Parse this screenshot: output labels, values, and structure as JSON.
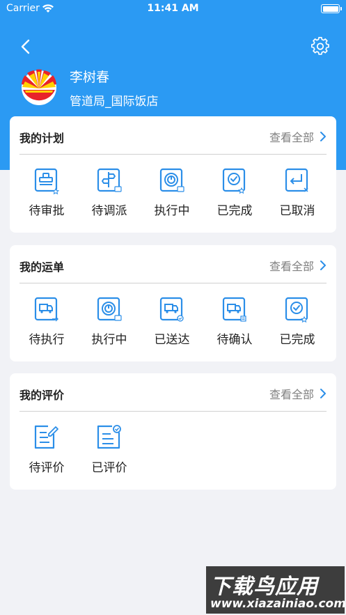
{
  "status_bar": {
    "carrier": "Carrier",
    "time": "11:41 AM"
  },
  "header": {
    "back_icon": "chevron-left-icon",
    "settings_icon": "gear-icon",
    "user_name": "李树春",
    "user_org": "管道局_国际饭店",
    "colors": {
      "primary": "#2b9af3",
      "icon_blue": "#2b8ee8"
    }
  },
  "plans": {
    "title": "我的计划",
    "more": "查看全部",
    "items": [
      {
        "label": "待审批",
        "icon": "pending-approval-icon"
      },
      {
        "label": "待调派",
        "icon": "pending-dispatch-icon"
      },
      {
        "label": "执行中",
        "icon": "in-progress-icon"
      },
      {
        "label": "已完成",
        "icon": "completed-icon"
      },
      {
        "label": "已取消",
        "icon": "cancelled-icon"
      }
    ]
  },
  "waybills": {
    "title": "我的运单",
    "more": "查看全部",
    "items": [
      {
        "label": "待执行",
        "icon": "truck-pending-icon"
      },
      {
        "label": "执行中",
        "icon": "in-progress-icon"
      },
      {
        "label": "已送达",
        "icon": "truck-delivered-icon"
      },
      {
        "label": "待确认",
        "icon": "truck-confirm-icon"
      },
      {
        "label": "已完成",
        "icon": "completed-icon"
      }
    ]
  },
  "reviews": {
    "title": "我的评价",
    "more": "查看全部",
    "items": [
      {
        "label": "待评价",
        "icon": "pending-review-icon"
      },
      {
        "label": "已评价",
        "icon": "reviewed-icon"
      }
    ]
  },
  "watermark": {
    "title": "下载鸟应用",
    "url": "www.xiazainiao.com"
  }
}
